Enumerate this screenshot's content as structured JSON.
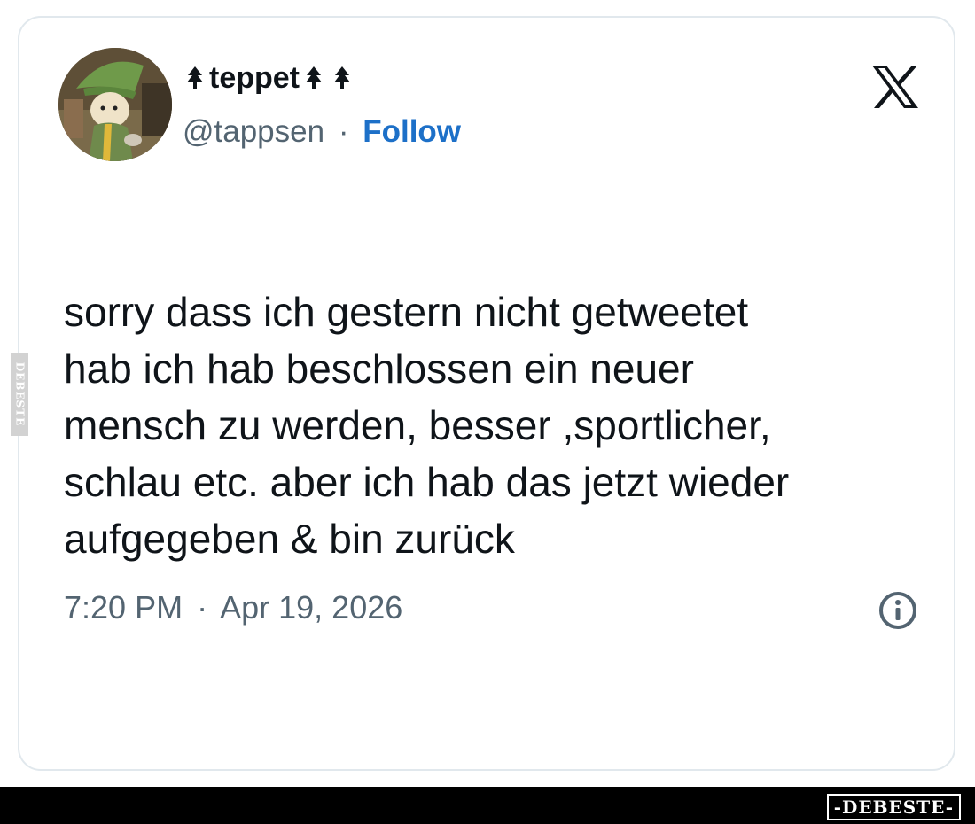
{
  "tweet": {
    "display_name": "teppet",
    "name_emoji": "evergreen-tree-emoji",
    "handle": "@tappsen",
    "separator": "·",
    "follow_label": "Follow",
    "text_lines": [
      "sorry dass ich gestern nicht getweetet",
      "hab ich hab beschlossen ein neuer",
      "mensch zu werden, besser ,sportlicher,",
      "schlau etc. aber ich hab das jetzt wieder",
      "aufgegeben & bin zurück"
    ],
    "time": "7:20 PM",
    "date": "Apr 19, 2026",
    "platform_logo": "x-logo-icon",
    "info_icon": "info-icon"
  },
  "watermark": {
    "footer": "-DEBESTE-",
    "side": "DEBESTE"
  },
  "colors": {
    "follow": "#1d70c8",
    "secondary_text": "#536471",
    "card_border": "#e1e8ed",
    "footer_bar": "#000000"
  }
}
